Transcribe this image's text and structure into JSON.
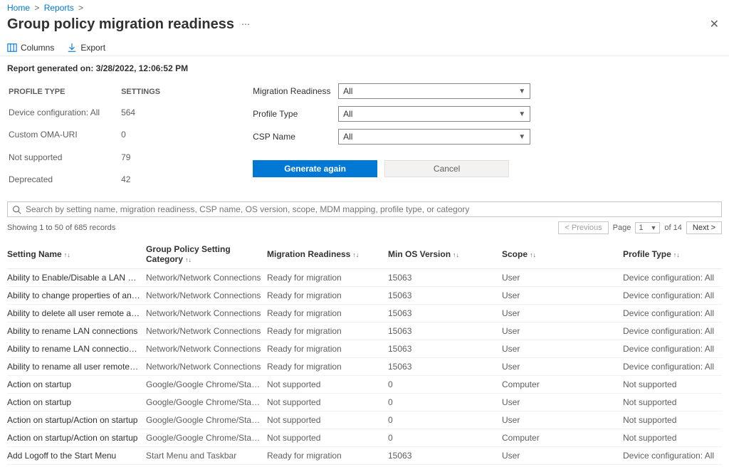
{
  "breadcrumb": {
    "home": "Home",
    "reports": "Reports"
  },
  "title": "Group policy migration readiness",
  "toolbar": {
    "columns": "Columns",
    "export": "Export"
  },
  "generated": {
    "label": "Report generated on:",
    "value": "3/28/2022, 12:06:52 PM"
  },
  "summary": {
    "headers": {
      "profile_type": "PROFILE TYPE",
      "settings": "SETTINGS"
    },
    "rows": [
      {
        "label": "Device configuration: All",
        "value": "564"
      },
      {
        "label": "Custom OMA-URI",
        "value": "0"
      },
      {
        "label": "Not supported",
        "value": "79"
      },
      {
        "label": "Deprecated",
        "value": "42"
      }
    ]
  },
  "filters": {
    "migration_readiness": {
      "label": "Migration Readiness",
      "value": "All"
    },
    "profile_type": {
      "label": "Profile Type",
      "value": "All"
    },
    "csp_name": {
      "label": "CSP Name",
      "value": "All"
    }
  },
  "actions": {
    "generate": "Generate again",
    "cancel": "Cancel"
  },
  "search": {
    "placeholder": "Search by setting name, migration readiness, CSP name, OS version, scope, MDM mapping, profile type, or category"
  },
  "records": {
    "showing": "Showing 1 to 50 of 685 records",
    "prev": "< Previous",
    "page_label": "Page",
    "page_value": "1",
    "of_label": "of 14",
    "next": "Next >"
  },
  "columns": {
    "setting_name": "Setting Name",
    "category": "Group Policy Setting Category",
    "migration": "Migration Readiness",
    "min_os": "Min OS Version",
    "scope": "Scope",
    "profile_type": "Profile Type"
  },
  "rows": [
    {
      "name": "Ability to Enable/Disable a LAN connection",
      "cat": "Network/Network Connections",
      "mig": "Ready for migration",
      "os": "15063",
      "scope": "User",
      "prof": "Device configuration: All"
    },
    {
      "name": "Ability to change properties of an all user re…",
      "cat": "Network/Network Connections",
      "mig": "Ready for migration",
      "os": "15063",
      "scope": "User",
      "prof": "Device configuration: All"
    },
    {
      "name": "Ability to delete all user remote access conn…",
      "cat": "Network/Network Connections",
      "mig": "Ready for migration",
      "os": "15063",
      "scope": "User",
      "prof": "Device configuration: All"
    },
    {
      "name": "Ability to rename LAN connections",
      "cat": "Network/Network Connections",
      "mig": "Ready for migration",
      "os": "15063",
      "scope": "User",
      "prof": "Device configuration: All"
    },
    {
      "name": "Ability to rename LAN connections or remot…",
      "cat": "Network/Network Connections",
      "mig": "Ready for migration",
      "os": "15063",
      "scope": "User",
      "prof": "Device configuration: All"
    },
    {
      "name": "Ability to rename all user remote access con…",
      "cat": "Network/Network Connections",
      "mig": "Ready for migration",
      "os": "15063",
      "scope": "User",
      "prof": "Device configuration: All"
    },
    {
      "name": "Action on startup",
      "cat": "Google/Google Chrome/Startup pages",
      "mig": "Not supported",
      "os": "0",
      "scope": "Computer",
      "prof": "Not supported"
    },
    {
      "name": "Action on startup",
      "cat": "Google/Google Chrome/Startup pages",
      "mig": "Not supported",
      "os": "0",
      "scope": "User",
      "prof": "Not supported"
    },
    {
      "name": "Action on startup/Action on startup",
      "cat": "Google/Google Chrome/Startup pages",
      "mig": "Not supported",
      "os": "0",
      "scope": "User",
      "prof": "Not supported"
    },
    {
      "name": "Action on startup/Action on startup",
      "cat": "Google/Google Chrome/Startup pages",
      "mig": "Not supported",
      "os": "0",
      "scope": "Computer",
      "prof": "Not supported"
    },
    {
      "name": "Add Logoff to the Start Menu",
      "cat": "Start Menu and Taskbar",
      "mig": "Ready for migration",
      "os": "15063",
      "scope": "User",
      "prof": "Device configuration: All"
    }
  ]
}
